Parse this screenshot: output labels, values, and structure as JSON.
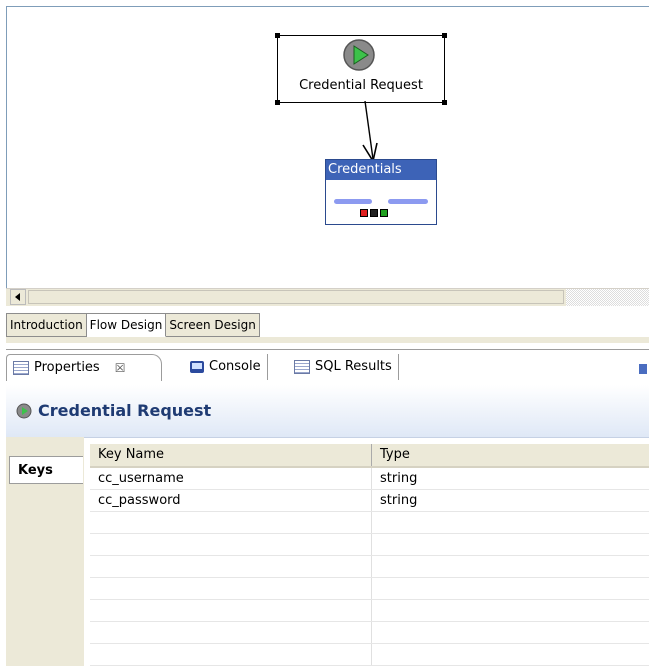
{
  "canvas": {
    "start_node": {
      "label": "Credential Request"
    },
    "screen_node": {
      "title": "Credentials"
    }
  },
  "editor_tabs": [
    {
      "label": "Introduction",
      "active": false
    },
    {
      "label": "Flow Design",
      "active": true
    },
    {
      "label": "Screen Design",
      "active": false
    }
  ],
  "view_tabs": {
    "properties": "Properties",
    "properties_close": "☒",
    "console": "Console",
    "sql_results": "SQL Results"
  },
  "properties": {
    "title": "Credential Request",
    "side_tab": "Keys",
    "columns": [
      "Key Name",
      "Type"
    ],
    "rows": [
      {
        "key": "cc_username",
        "type": "string"
      },
      {
        "key": "cc_password",
        "type": "string"
      },
      {
        "key": "",
        "type": ""
      },
      {
        "key": "",
        "type": ""
      },
      {
        "key": "",
        "type": ""
      },
      {
        "key": "",
        "type": ""
      },
      {
        "key": "",
        "type": ""
      },
      {
        "key": "",
        "type": ""
      },
      {
        "key": "",
        "type": ""
      }
    ]
  },
  "colors": {
    "screen_title_bg": "#3d63b7",
    "start_green": "#3cc24a",
    "header_title": "#1f3b73",
    "port_red": "#e02020",
    "port_black": "#000000",
    "port_green": "#20a020"
  }
}
